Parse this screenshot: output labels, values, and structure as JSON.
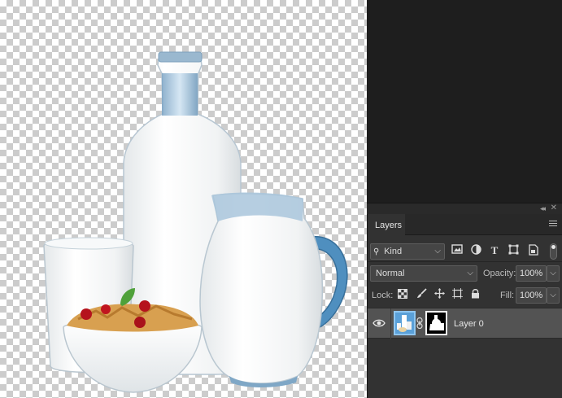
{
  "panel": {
    "tab_label": "Layers",
    "filter": {
      "kind_label": "Kind"
    },
    "blend_mode": "Normal",
    "opacity_label": "Opacity:",
    "opacity_value": "100%",
    "lock_label": "Lock:",
    "fill_label": "Fill:",
    "fill_value": "100%"
  },
  "layers": [
    {
      "name": "Layer 0",
      "visible": true,
      "has_mask": true,
      "selected": true
    }
  ],
  "icons": {
    "filter_icons": [
      "image-filter-icon",
      "adjustment-filter-icon",
      "type-filter-icon",
      "shape-filter-icon",
      "smart-object-filter-icon"
    ],
    "lock_icons": [
      "lock-transparent-pixels-icon",
      "lock-image-pixels-icon",
      "lock-position-icon",
      "lock-artboard-icon",
      "lock-all-icon"
    ]
  },
  "colors": {
    "panel_bg": "#323232",
    "selected_layer_bg": "#535353",
    "app_bg": "#1e1e1e"
  }
}
